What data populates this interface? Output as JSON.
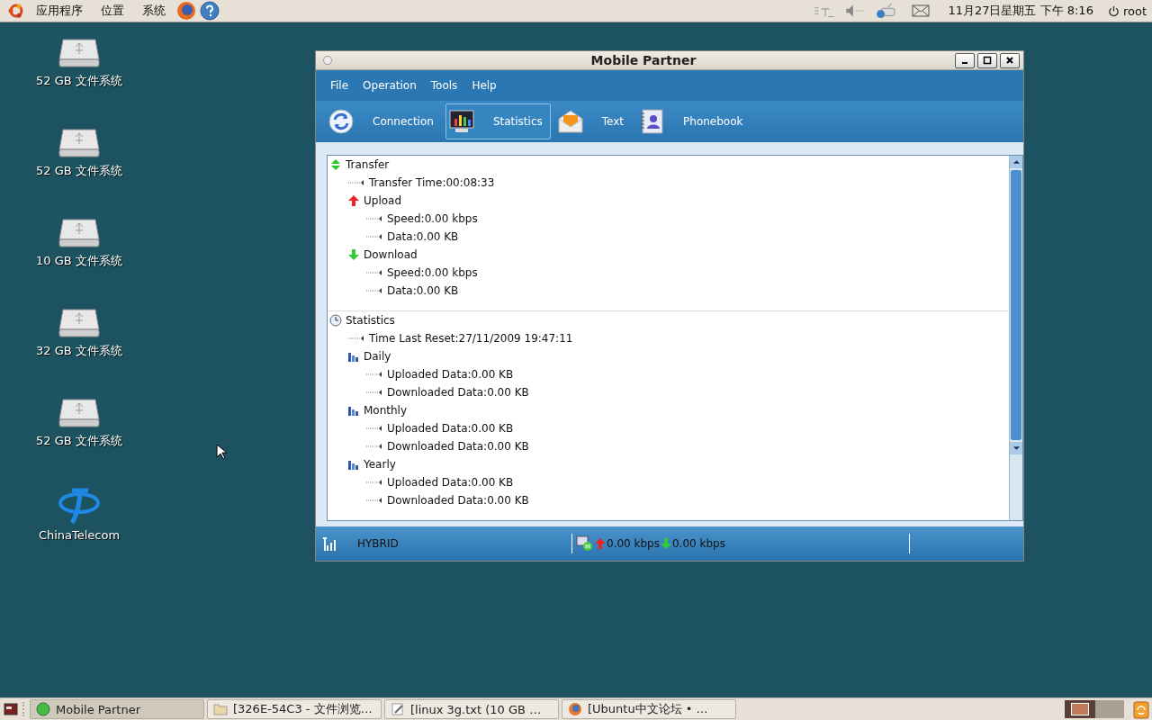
{
  "top_panel": {
    "menus": [
      "应用程序",
      "位置",
      "系统"
    ],
    "clock": "11月27日星期五 下午 8:16",
    "user": "root"
  },
  "desktop_icons": [
    {
      "label": "52 GB 文件系统",
      "kind": "drive"
    },
    {
      "label": "52 GB 文件系统",
      "kind": "drive"
    },
    {
      "label": "10 GB 文件系统",
      "kind": "drive"
    },
    {
      "label": "32 GB 文件系统",
      "kind": "drive"
    },
    {
      "label": "52 GB 文件系统",
      "kind": "drive"
    },
    {
      "label": "ChinaTelecom",
      "kind": "logo"
    }
  ],
  "window": {
    "title": "Mobile Partner",
    "menu": [
      "File",
      "Operation",
      "Tools",
      "Help"
    ],
    "tabs": [
      {
        "label": "Connection",
        "kind": "connection",
        "selected": false
      },
      {
        "label": "Statistics",
        "kind": "statistics",
        "selected": true
      },
      {
        "label": "Text",
        "kind": "text",
        "selected": false
      },
      {
        "label": "Phonebook",
        "kind": "phonebook",
        "selected": false
      }
    ],
    "tree": [
      {
        "label": "Transfer",
        "kind": "transfer",
        "children": [
          {
            "label": "Transfer Time:00:08:33",
            "kind": "leaf"
          },
          {
            "label": "Upload",
            "kind": "upload",
            "children": [
              {
                "label": "Speed:0.00 kbps",
                "kind": "leaf"
              },
              {
                "label": "Data:0.00 KB",
                "kind": "leaf"
              }
            ]
          },
          {
            "label": "Download",
            "kind": "download",
            "children": [
              {
                "label": "Speed:0.00 kbps",
                "kind": "leaf"
              },
              {
                "label": "Data:0.00 KB",
                "kind": "leaf"
              }
            ]
          }
        ]
      },
      {
        "label": "Statistics",
        "kind": "clock",
        "children": [
          {
            "label": "Time Last Reset:27/11/2009 19:47:11",
            "kind": "leaf"
          },
          {
            "label": "Daily",
            "kind": "bars",
            "children": [
              {
                "label": "Uploaded Data:0.00 KB",
                "kind": "leaf"
              },
              {
                "label": "Downloaded Data:0.00 KB",
                "kind": "leaf"
              }
            ]
          },
          {
            "label": "Monthly",
            "kind": "bars",
            "children": [
              {
                "label": "Uploaded Data:0.00 KB",
                "kind": "leaf"
              },
              {
                "label": "Downloaded Data:0.00 KB",
                "kind": "leaf"
              }
            ]
          },
          {
            "label": "Yearly",
            "kind": "bars",
            "children": [
              {
                "label": "Uploaded Data:0.00 KB",
                "kind": "leaf"
              },
              {
                "label": "Downloaded Data:0.00 KB",
                "kind": "leaf"
              }
            ]
          }
        ]
      }
    ],
    "status": {
      "network": "HYBRID",
      "upload": "0.00 kbps",
      "download": "0.00 kbps"
    }
  },
  "taskbar": [
    {
      "label": "Mobile Partner",
      "kind": "app",
      "selected": true
    },
    {
      "label": "[326E-54C3 - 文件浏览…",
      "kind": "folder",
      "selected": false
    },
    {
      "label": "[linux 3g.txt (10 GB …",
      "kind": "editor",
      "selected": false
    },
    {
      "label": "[Ubuntu中文论坛 • …",
      "kind": "browser",
      "selected": false
    }
  ]
}
